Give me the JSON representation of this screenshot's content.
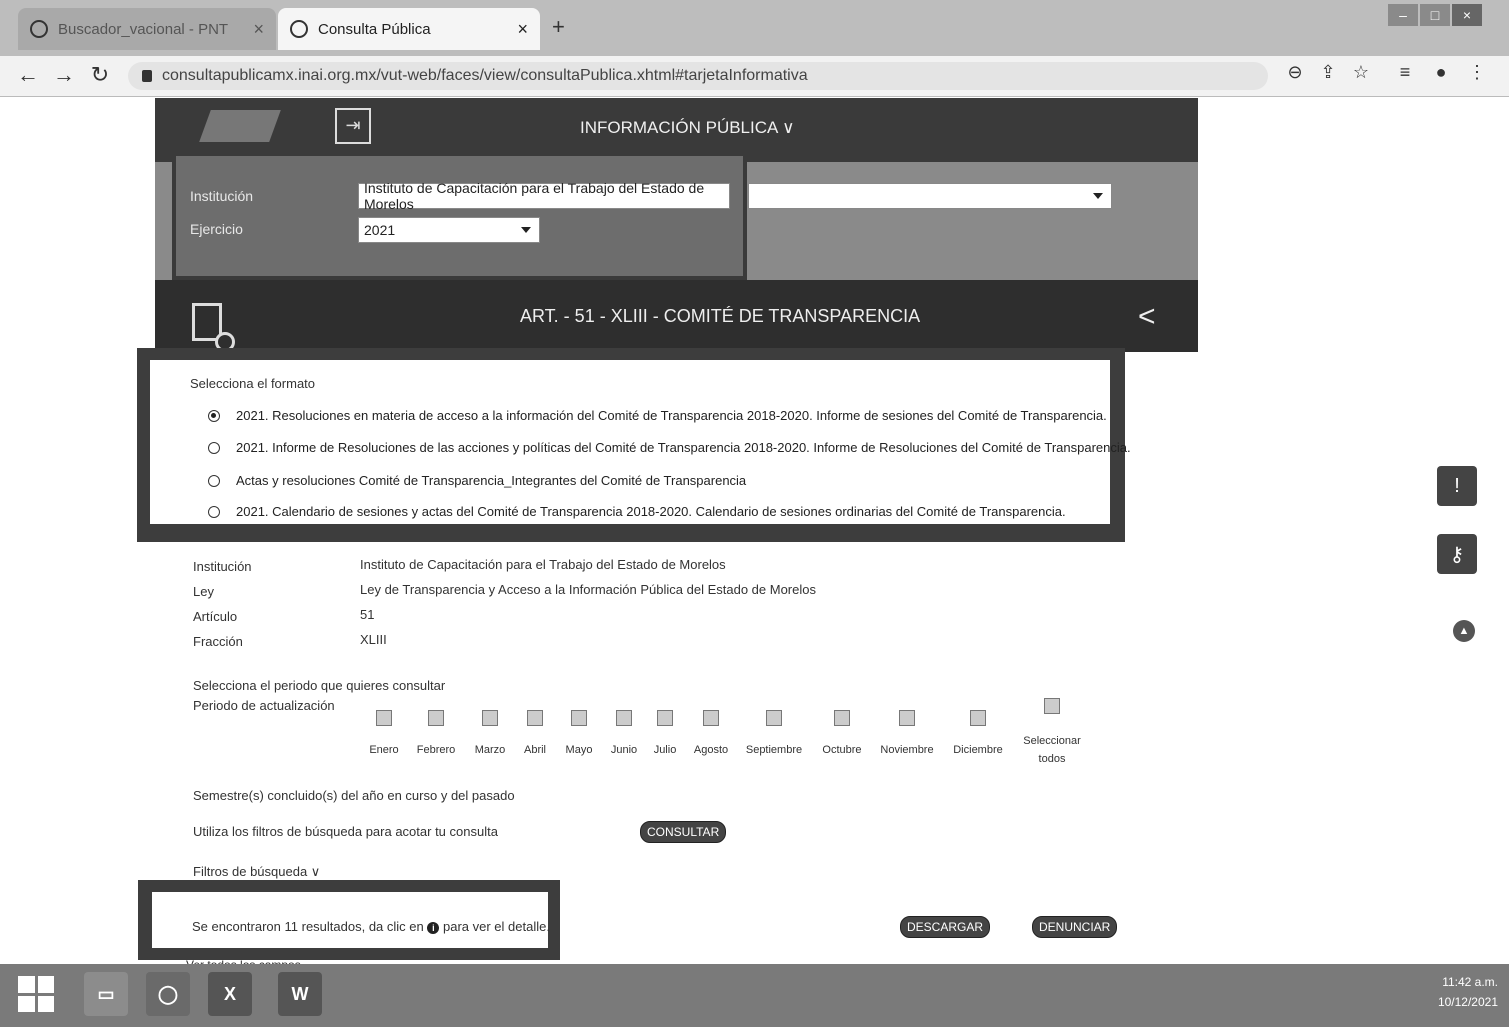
{
  "browser": {
    "tabs": [
      {
        "label": "Buscador_vacional - PNT"
      },
      {
        "label": "Consulta Pública"
      }
    ],
    "url": "consultapublicamx.inai.org.mx/vut-web/faces/view/consultaPublica.xhtml#tarjetaInformativa"
  },
  "header": {
    "nav_label": "INFORMACIÓN PÚBLICA ∨"
  },
  "filters": {
    "institution_label": "Institución",
    "institution_value": "Instituto de Capacitación para el Trabajo del Estado de Morelos",
    "year_label": "Ejercicio",
    "year_value": "2021",
    "second_select_value": ""
  },
  "article": {
    "title": "ART. - 51 - XLIII - COMITÉ DE TRANSPARENCIA"
  },
  "format": {
    "label": "Selecciona el formato",
    "options": [
      {
        "label": "2021. Resoluciones en materia de acceso a la información del Comité de Transparencia 2018-2020. Informe de sesiones del Comité de Transparencia.",
        "selected": true
      },
      {
        "label": "2021. Informe de Resoluciones de las acciones y políticas del Comité de Transparencia 2018-2020. Informe de Resoluciones del Comité de Transparencia.",
        "selected": false
      },
      {
        "label": "Actas y resoluciones Comité de Transparencia_Integrantes del Comité de Transparencia",
        "selected": false
      },
      {
        "label": "2021. Calendario de sesiones y actas del Comité de Transparencia 2018-2020. Calendario de sesiones ordinarias del Comité de Transparencia.",
        "selected": false
      }
    ]
  },
  "details": [
    {
      "label": "Institución",
      "value": "Instituto de Capacitación para el Trabajo del Estado de Morelos"
    },
    {
      "label": "Ley",
      "value": "Ley de Transparencia y Acceso a la Información Pública del Estado de Morelos"
    },
    {
      "label": "Artículo",
      "value": "51"
    },
    {
      "label": "Fracción",
      "value": "XLIII"
    }
  ],
  "period": {
    "prompt": "Selecciona el periodo que quieres consultar",
    "update_label": "Periodo de actualización",
    "months": [
      "Enero",
      "Febrero",
      "Marzo",
      "Abril",
      "Mayo",
      "Junio",
      "Julio",
      "Agosto",
      "Septiembre",
      "Octubre",
      "Noviembre",
      "Diciembre"
    ],
    "select_all": "Seleccionar todos",
    "semester_text": "Semestre(s) concluido(s) del año en curso y del pasado"
  },
  "actions": {
    "filter_hint": "Utiliza los filtros de búsqueda para acotar tu consulta",
    "consult": "CONSULTAR",
    "filters_toggle": "Filtros de búsqueda ∨",
    "results_before": "Se encontraron 11 resultados, da clic en",
    "results_after": "para ver el detalle.",
    "download": "DESCARGAR",
    "report": "DENUNCIAR",
    "view_all": "Ver todos los campos"
  },
  "taskbar": {
    "time": "11:42 a.m.",
    "date": "10/12/2021"
  },
  "colors": {
    "header_dark": "#3a3a3a",
    "band_gray": "#8a8a8a"
  }
}
